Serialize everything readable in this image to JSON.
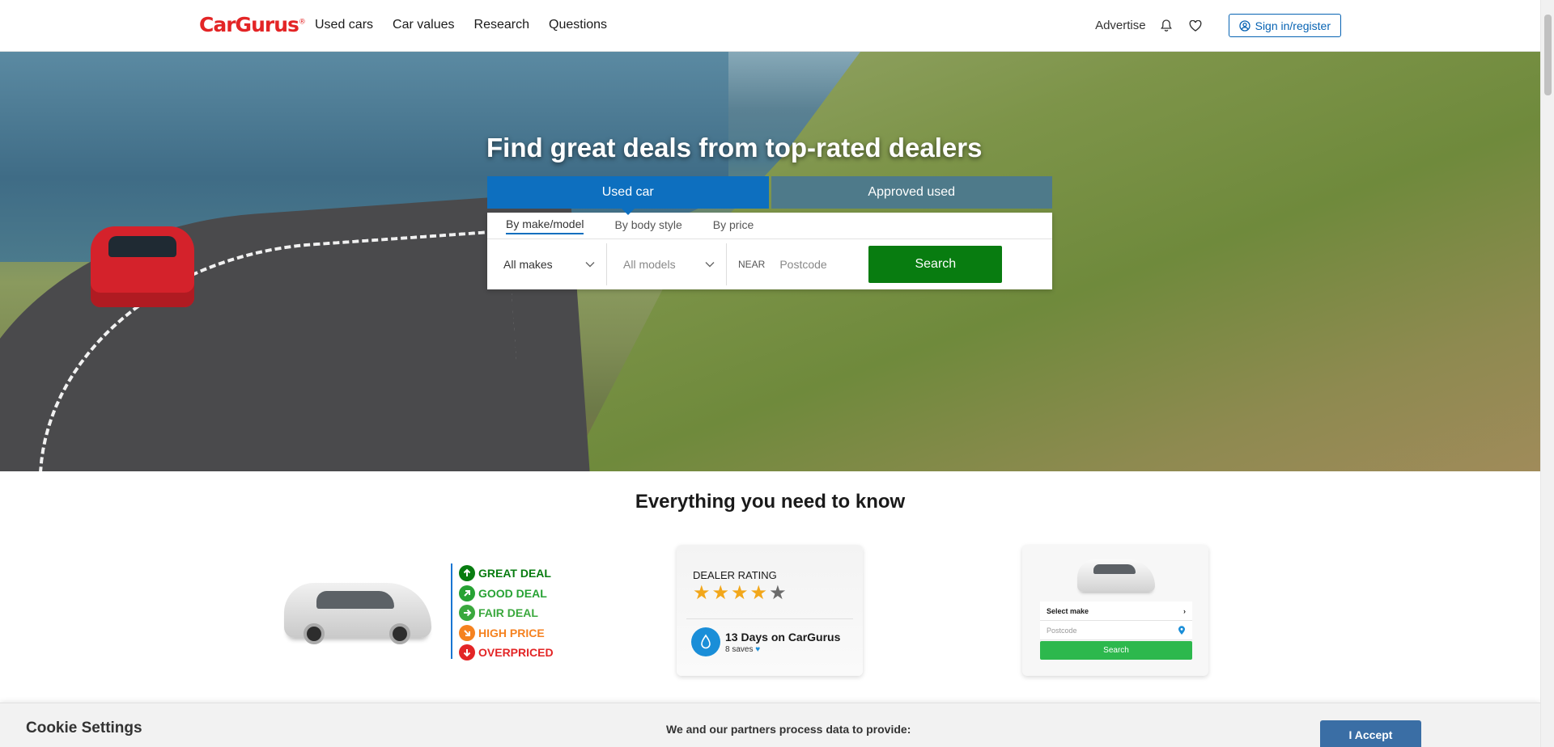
{
  "header": {
    "logo": "CarGurus",
    "logo_mark": "®",
    "nav": [
      "Used cars",
      "Car values",
      "Research",
      "Questions"
    ],
    "advertise": "Advertise",
    "bell_icon": "bell-icon",
    "heart_icon": "heart-icon",
    "signin": "Sign in/register"
  },
  "hero": {
    "title": "Find great deals from top-rated dealers",
    "tabs": [
      {
        "label": "Used car",
        "active": true
      },
      {
        "label": "Approved used",
        "active": false
      }
    ],
    "subtabs": [
      {
        "label": "By make/model",
        "active": true
      },
      {
        "label": "By body style",
        "active": false
      },
      {
        "label": "By price",
        "active": false
      }
    ],
    "make_select": "All makes",
    "model_select": "All models",
    "near_label": "NEAR",
    "postcode_placeholder": "Postcode",
    "search_button": "Search"
  },
  "info": {
    "section_title": "Everything you need to know",
    "deal_ratings": [
      {
        "label": "GREAT DEAL",
        "color": "#087c10",
        "icon": "arrow-up-icon"
      },
      {
        "label": "GOOD DEAL",
        "color": "#27a234",
        "icon": "arrow-up-right-icon"
      },
      {
        "label": "FAIR DEAL",
        "color": "#3aa83d",
        "icon": "arrow-right-icon"
      },
      {
        "label": "HIGH PRICE",
        "color": "#f58220",
        "icon": "arrow-down-right-icon"
      },
      {
        "label": "OVERPRICED",
        "color": "#e32526",
        "icon": "arrow-down-icon"
      }
    ],
    "dealer_rating": {
      "title": "DEALER RATING",
      "stars_filled": 4,
      "stars_total": 5,
      "days": "13 Days on CarGurus",
      "saves": "8 saves"
    },
    "mini_search": {
      "select_make": "Select make",
      "postcode": "Postcode",
      "button": "Search"
    }
  },
  "cookie": {
    "title": "Cookie Settings",
    "text": "We and our partners process data to provide:",
    "accept": "I Accept"
  },
  "colors": {
    "brand_red": "#e32526",
    "primary_blue": "#0d6fbf",
    "search_green": "#087c10"
  }
}
